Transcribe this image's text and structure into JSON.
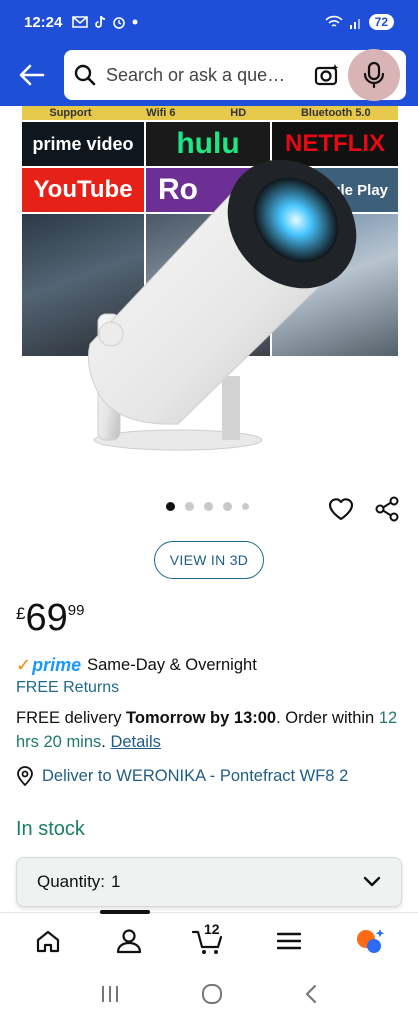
{
  "status_bar": {
    "time": "12:24",
    "left_icons": [
      "mail-icon",
      "tiktok-icon",
      "alarm-icon",
      "dot-icon"
    ],
    "right_icons": [
      "wifi-icon",
      "signal-icon"
    ],
    "battery": "72"
  },
  "search": {
    "placeholder": "Search or ask a que…"
  },
  "product_image": {
    "feature_labels": [
      "Support",
      "Wifi 6",
      "HD",
      "Bluetooth 5.0"
    ],
    "logos": [
      "prime video",
      "hulu",
      "NETFLIX",
      "YouTube",
      "Ro",
      "ogle Play"
    ]
  },
  "carousel": {
    "count": 5,
    "active_index": 0
  },
  "view3d": {
    "label": "VIEW IN 3D"
  },
  "price": {
    "symbol": "£",
    "whole": "69",
    "fraction": "99"
  },
  "prime": {
    "check": "✓",
    "logo": "prime",
    "text": "Same-Day & Overnight"
  },
  "returns": {
    "label": "FREE Returns"
  },
  "delivery": {
    "prefix": "FREE delivery ",
    "date": "Tomorrow by 13:00",
    "middle": ". Order within ",
    "countdown": "12 hrs 20 mins",
    "after": ". ",
    "details_link": "Details"
  },
  "deliver_to": {
    "label": "Deliver to WERONIKA - Pontefract WF8 2"
  },
  "stock": {
    "label": "In stock"
  },
  "quantity": {
    "label": "Quantity:",
    "value": "1"
  },
  "bottom_nav": {
    "cart_count": "12",
    "items": [
      "home-icon",
      "account-icon",
      "cart-icon",
      "menu-icon",
      "rufus-icon"
    ]
  },
  "colors": {
    "header_blue": "#1f4fd8",
    "link_blue": "#1f5d87",
    "stock_green": "#1a7f66",
    "prime_blue": "#1a98ff",
    "prime_orange": "#f08804"
  }
}
